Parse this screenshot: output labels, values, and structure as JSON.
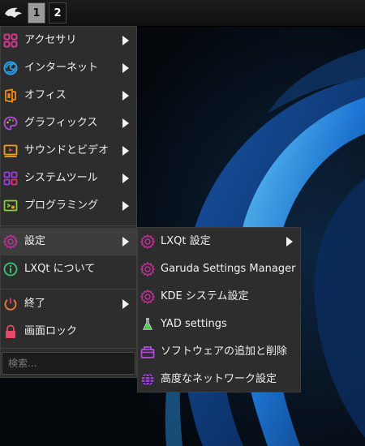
{
  "panel": {
    "workspaces": [
      "1",
      "2"
    ]
  },
  "main_menu": {
    "items": [
      {
        "label": "アクセサリ",
        "icon": "accessories-icon"
      },
      {
        "label": "インターネット",
        "icon": "internet-icon"
      },
      {
        "label": "オフィス",
        "icon": "office-icon"
      },
      {
        "label": "グラフィックス",
        "icon": "graphics-icon"
      },
      {
        "label": "サウンドとビデオ",
        "icon": "multimedia-icon"
      },
      {
        "label": "システムツール",
        "icon": "system-tools-icon"
      },
      {
        "label": "プログラミング",
        "icon": "programming-icon"
      },
      {
        "label": "設定",
        "icon": "settings-icon"
      },
      {
        "label": "LXQt について",
        "icon": "about-icon"
      },
      {
        "label": "終了",
        "icon": "power-icon"
      },
      {
        "label": "画面ロック",
        "icon": "lock-icon"
      }
    ],
    "search_placeholder": "検索..."
  },
  "sub_menu": {
    "items": [
      {
        "label": "LXQt 設定",
        "icon": "settings-icon"
      },
      {
        "label": "Garuda Settings Manager",
        "icon": "settings-icon"
      },
      {
        "label": "KDE システム設定",
        "icon": "settings-icon"
      },
      {
        "label": "YAD settings",
        "icon": "flask-icon"
      },
      {
        "label": "ソフトウェアの追加と削除",
        "icon": "package-icon"
      },
      {
        "label": "高度なネットワーク設定",
        "icon": "network-globe-icon"
      }
    ]
  },
  "colors": {
    "menu_bg": "#2d2d2d",
    "highlight": "#3d3d3d",
    "accent_magenta": "#c0309a",
    "accent_blue": "#2a8fe0"
  }
}
